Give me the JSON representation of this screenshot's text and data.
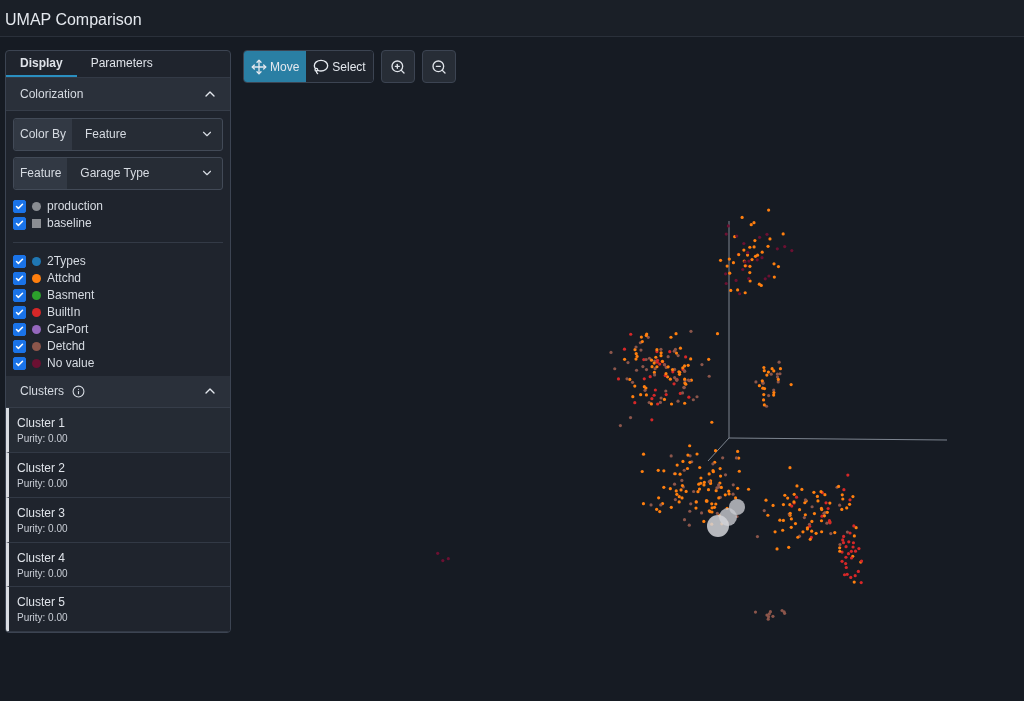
{
  "header": {
    "title": "UMAP Comparison"
  },
  "panel": {
    "tabs": [
      {
        "label": "Display",
        "selected": true
      },
      {
        "label": "Parameters",
        "selected": false
      }
    ],
    "colorization": {
      "title": "Colorization",
      "expanded": true,
      "selects": [
        {
          "label": "Color By",
          "value": "Feature"
        },
        {
          "label": "Feature",
          "value": "Garage Type"
        }
      ],
      "datasets": [
        {
          "label": "production",
          "checked": true,
          "kind": "circle"
        },
        {
          "label": "baseline",
          "checked": true,
          "kind": "square"
        }
      ],
      "categories": [
        {
          "label": "2Types",
          "checked": true,
          "color": "#1f77b4"
        },
        {
          "label": "Attchd",
          "checked": true,
          "color": "#ff7f0e"
        },
        {
          "label": "Basment",
          "checked": true,
          "color": "#2ca02c"
        },
        {
          "label": "BuiltIn",
          "checked": true,
          "color": "#d62728"
        },
        {
          "label": "CarPort",
          "checked": true,
          "color": "#9467bd"
        },
        {
          "label": "Detchd",
          "checked": true,
          "color": "#8c564b"
        },
        {
          "label": "No value",
          "checked": true,
          "color": "#6b1032"
        }
      ]
    },
    "clusters": {
      "title": "Clusters",
      "expanded": true,
      "items": [
        {
          "name": "Cluster 1",
          "purity": "Purity: 0.00"
        },
        {
          "name": "Cluster 2",
          "purity": "Purity: 0.00"
        },
        {
          "name": "Cluster 3",
          "purity": "Purity: 0.00"
        },
        {
          "name": "Cluster 4",
          "purity": "Purity: 0.00"
        },
        {
          "name": "Cluster 5",
          "purity": "Purity: 0.00"
        }
      ]
    }
  },
  "toolbar": {
    "modes": [
      {
        "label": "Move",
        "selected": true,
        "kind": "move"
      },
      {
        "label": "Select",
        "selected": false,
        "kind": "lasso"
      }
    ]
  }
}
